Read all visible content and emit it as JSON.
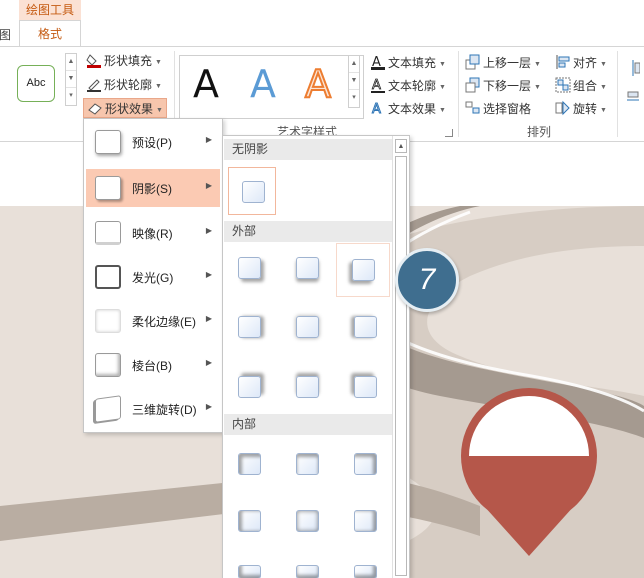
{
  "ribbon": {
    "context_tab": "绘图工具",
    "cut_tab_fragment": "图",
    "active_tab": "格式",
    "shape_style_preview": "Abc",
    "shape_fill": "形状填充",
    "shape_outline": "形状轮廓",
    "shape_effects": "形状效果",
    "wordart_letter": "A",
    "wordart_group": "艺术字样式",
    "text_fill": "文本填充",
    "text_outline": "文本轮廓",
    "text_effects": "文本效果",
    "bring_forward": "上移一层",
    "send_backward": "下移一层",
    "selection_pane": "选择窗格",
    "align": "对齐",
    "group": "组合",
    "rotate": "旋转",
    "arrange_group": "排列"
  },
  "effects_menu": {
    "items": [
      {
        "label": "预设(P)"
      },
      {
        "label": "阴影(S)"
      },
      {
        "label": "映像(R)"
      },
      {
        "label": "发光(G)"
      },
      {
        "label": "柔化边缘(E)"
      },
      {
        "label": "棱台(B)"
      },
      {
        "label": "三维旋转(D)"
      }
    ]
  },
  "shadow_gallery": {
    "no_shadow": "无阴影",
    "outer": "外部",
    "inner": "内部"
  },
  "step_badge": "7",
  "colors": {
    "accent": "#c55a11",
    "hover_highlight": "#fbcab3",
    "badge_blue": "#3f6e8f",
    "pin_red": "#b5574a"
  }
}
